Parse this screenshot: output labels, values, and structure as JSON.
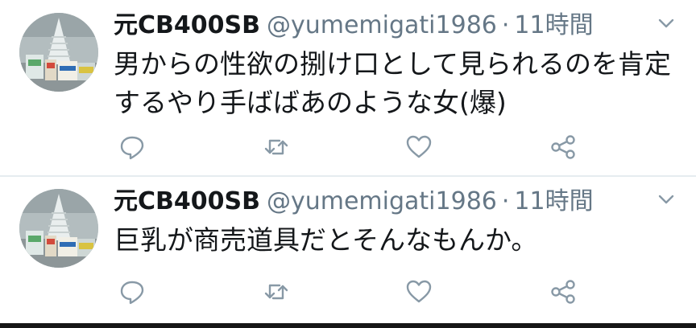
{
  "tweets": [
    {
      "display_name": "元CB400SB",
      "handle": "@yumemigati1986",
      "separator": "·",
      "time": "11時間",
      "text": "男からの性欲の捌け口として見られるのを肯定するやり手ばばあのような女(爆)"
    },
    {
      "display_name": "元CB400SB",
      "handle": "@yumemigati1986",
      "separator": "·",
      "time": "11時間",
      "text": "巨乳が商売道具だとそんなもんか。"
    }
  ],
  "icons": {
    "reply": "reply-icon",
    "retweet": "retweet-icon",
    "like": "heart-icon",
    "share": "share-icon",
    "more": "chevron-down-icon"
  },
  "colors": {
    "text": "#14171a",
    "secondary": "#657786",
    "icon": "#8899a6",
    "divider": "#e6ecf0"
  }
}
